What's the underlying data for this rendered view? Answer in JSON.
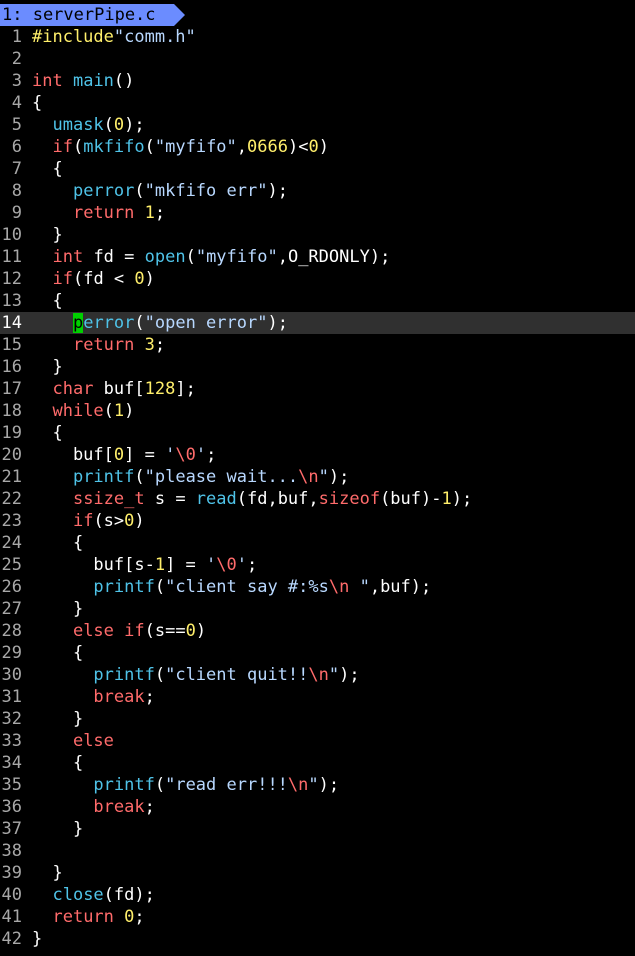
{
  "tab": {
    "label": "1: serverPipe.c"
  },
  "editor": {
    "current_line": 14,
    "lines": [
      [
        {
          "t": "#include",
          "c": "pp"
        },
        {
          "t": "\"comm.h\"",
          "c": "str"
        }
      ],
      [],
      [
        {
          "t": "int",
          "c": "ty"
        },
        {
          "t": " ",
          "c": "txt"
        },
        {
          "t": "main",
          "c": "fn"
        },
        {
          "t": "()",
          "c": "txt"
        }
      ],
      [
        {
          "t": "{",
          "c": "txt"
        }
      ],
      [
        {
          "t": "  ",
          "c": "txt"
        },
        {
          "t": "umask",
          "c": "fn"
        },
        {
          "t": "(",
          "c": "txt"
        },
        {
          "t": "0",
          "c": "num"
        },
        {
          "t": ");",
          "c": "txt"
        }
      ],
      [
        {
          "t": "  ",
          "c": "txt"
        },
        {
          "t": "if",
          "c": "kw"
        },
        {
          "t": "(",
          "c": "txt"
        },
        {
          "t": "mkfifo",
          "c": "fn"
        },
        {
          "t": "(",
          "c": "txt"
        },
        {
          "t": "\"myfifo\"",
          "c": "str"
        },
        {
          "t": ",",
          "c": "txt"
        },
        {
          "t": "0666",
          "c": "num"
        },
        {
          "t": ")<",
          "c": "txt"
        },
        {
          "t": "0",
          "c": "num"
        },
        {
          "t": ")",
          "c": "txt"
        }
      ],
      [
        {
          "t": "  {",
          "c": "txt"
        }
      ],
      [
        {
          "t": "    ",
          "c": "txt"
        },
        {
          "t": "perror",
          "c": "fn"
        },
        {
          "t": "(",
          "c": "txt"
        },
        {
          "t": "\"mkfifo err\"",
          "c": "str"
        },
        {
          "t": ");",
          "c": "txt"
        }
      ],
      [
        {
          "t": "    ",
          "c": "txt"
        },
        {
          "t": "return",
          "c": "kw"
        },
        {
          "t": " ",
          "c": "txt"
        },
        {
          "t": "1",
          "c": "num"
        },
        {
          "t": ";",
          "c": "txt"
        }
      ],
      [
        {
          "t": "  }",
          "c": "txt"
        }
      ],
      [
        {
          "t": "  ",
          "c": "txt"
        },
        {
          "t": "int",
          "c": "ty"
        },
        {
          "t": " fd = ",
          "c": "txt"
        },
        {
          "t": "open",
          "c": "fn"
        },
        {
          "t": "(",
          "c": "txt"
        },
        {
          "t": "\"myfifo\"",
          "c": "str"
        },
        {
          "t": ",O_RDONLY);",
          "c": "txt"
        }
      ],
      [
        {
          "t": "  ",
          "c": "txt"
        },
        {
          "t": "if",
          "c": "kw"
        },
        {
          "t": "(fd < ",
          "c": "txt"
        },
        {
          "t": "0",
          "c": "num"
        },
        {
          "t": ")",
          "c": "txt"
        }
      ],
      [
        {
          "t": "  {",
          "c": "txt"
        }
      ],
      [
        {
          "t": "    ",
          "c": "txt"
        },
        {
          "t": "p",
          "c": "cursor"
        },
        {
          "t": "error",
          "c": "fn"
        },
        {
          "t": "(",
          "c": "txt"
        },
        {
          "t": "\"open error\"",
          "c": "str"
        },
        {
          "t": ");",
          "c": "txt"
        }
      ],
      [
        {
          "t": "    ",
          "c": "txt"
        },
        {
          "t": "return",
          "c": "kw"
        },
        {
          "t": " ",
          "c": "txt"
        },
        {
          "t": "3",
          "c": "num"
        },
        {
          "t": ";",
          "c": "txt"
        }
      ],
      [
        {
          "t": "  }",
          "c": "txt"
        }
      ],
      [
        {
          "t": "  ",
          "c": "txt"
        },
        {
          "t": "char",
          "c": "ty"
        },
        {
          "t": " buf[",
          "c": "txt"
        },
        {
          "t": "128",
          "c": "num"
        },
        {
          "t": "];",
          "c": "txt"
        }
      ],
      [
        {
          "t": "  ",
          "c": "txt"
        },
        {
          "t": "while",
          "c": "kw"
        },
        {
          "t": "(",
          "c": "txt"
        },
        {
          "t": "1",
          "c": "num"
        },
        {
          "t": ")",
          "c": "txt"
        }
      ],
      [
        {
          "t": "  {",
          "c": "txt"
        }
      ],
      [
        {
          "t": "    buf[",
          "c": "txt"
        },
        {
          "t": "0",
          "c": "num"
        },
        {
          "t": "] = ",
          "c": "txt"
        },
        {
          "t": "'",
          "c": "str"
        },
        {
          "t": "\\0",
          "c": "esc"
        },
        {
          "t": "'",
          "c": "str"
        },
        {
          "t": ";",
          "c": "txt"
        }
      ],
      [
        {
          "t": "    ",
          "c": "txt"
        },
        {
          "t": "printf",
          "c": "fn"
        },
        {
          "t": "(",
          "c": "txt"
        },
        {
          "t": "\"please wait...",
          "c": "str"
        },
        {
          "t": "\\n",
          "c": "esc"
        },
        {
          "t": "\"",
          "c": "str"
        },
        {
          "t": ");",
          "c": "txt"
        }
      ],
      [
        {
          "t": "    ",
          "c": "txt"
        },
        {
          "t": "ssize_t",
          "c": "ty"
        },
        {
          "t": " s = ",
          "c": "txt"
        },
        {
          "t": "read",
          "c": "fn"
        },
        {
          "t": "(fd,buf,",
          "c": "txt"
        },
        {
          "t": "sizeof",
          "c": "kw"
        },
        {
          "t": "(buf)-",
          "c": "txt"
        },
        {
          "t": "1",
          "c": "num"
        },
        {
          "t": ");",
          "c": "txt"
        }
      ],
      [
        {
          "t": "    ",
          "c": "txt"
        },
        {
          "t": "if",
          "c": "kw"
        },
        {
          "t": "(s>",
          "c": "txt"
        },
        {
          "t": "0",
          "c": "num"
        },
        {
          "t": ")",
          "c": "txt"
        }
      ],
      [
        {
          "t": "    {",
          "c": "txt"
        }
      ],
      [
        {
          "t": "      buf[s-",
          "c": "txt"
        },
        {
          "t": "1",
          "c": "num"
        },
        {
          "t": "] = ",
          "c": "txt"
        },
        {
          "t": "'",
          "c": "str"
        },
        {
          "t": "\\0",
          "c": "esc"
        },
        {
          "t": "'",
          "c": "str"
        },
        {
          "t": ";",
          "c": "txt"
        }
      ],
      [
        {
          "t": "      ",
          "c": "txt"
        },
        {
          "t": "printf",
          "c": "fn"
        },
        {
          "t": "(",
          "c": "txt"
        },
        {
          "t": "\"client say #:%s",
          "c": "str"
        },
        {
          "t": "\\n",
          "c": "esc"
        },
        {
          "t": " \"",
          "c": "str"
        },
        {
          "t": ",buf);",
          "c": "txt"
        }
      ],
      [
        {
          "t": "    }",
          "c": "txt"
        }
      ],
      [
        {
          "t": "    ",
          "c": "txt"
        },
        {
          "t": "else",
          "c": "kw"
        },
        {
          "t": " ",
          "c": "txt"
        },
        {
          "t": "if",
          "c": "kw"
        },
        {
          "t": "(s==",
          "c": "txt"
        },
        {
          "t": "0",
          "c": "num"
        },
        {
          "t": ")",
          "c": "txt"
        }
      ],
      [
        {
          "t": "    {",
          "c": "txt"
        }
      ],
      [
        {
          "t": "      ",
          "c": "txt"
        },
        {
          "t": "printf",
          "c": "fn"
        },
        {
          "t": "(",
          "c": "txt"
        },
        {
          "t": "\"client quit!!",
          "c": "str"
        },
        {
          "t": "\\n",
          "c": "esc"
        },
        {
          "t": "\"",
          "c": "str"
        },
        {
          "t": ");",
          "c": "txt"
        }
      ],
      [
        {
          "t": "      ",
          "c": "txt"
        },
        {
          "t": "break",
          "c": "kw"
        },
        {
          "t": ";",
          "c": "txt"
        }
      ],
      [
        {
          "t": "    }",
          "c": "txt"
        }
      ],
      [
        {
          "t": "    ",
          "c": "txt"
        },
        {
          "t": "else",
          "c": "kw"
        }
      ],
      [
        {
          "t": "    {",
          "c": "txt"
        }
      ],
      [
        {
          "t": "      ",
          "c": "txt"
        },
        {
          "t": "printf",
          "c": "fn"
        },
        {
          "t": "(",
          "c": "txt"
        },
        {
          "t": "\"read err!!!",
          "c": "str"
        },
        {
          "t": "\\n",
          "c": "esc"
        },
        {
          "t": "\"",
          "c": "str"
        },
        {
          "t": ");",
          "c": "txt"
        }
      ],
      [
        {
          "t": "      ",
          "c": "txt"
        },
        {
          "t": "break",
          "c": "kw"
        },
        {
          "t": ";",
          "c": "txt"
        }
      ],
      [
        {
          "t": "    }",
          "c": "txt"
        }
      ],
      [],
      [
        {
          "t": "  }",
          "c": "txt"
        }
      ],
      [
        {
          "t": "  ",
          "c": "txt"
        },
        {
          "t": "close",
          "c": "fn"
        },
        {
          "t": "(fd);",
          "c": "txt"
        }
      ],
      [
        {
          "t": "  ",
          "c": "txt"
        },
        {
          "t": "return",
          "c": "kw"
        },
        {
          "t": " ",
          "c": "txt"
        },
        {
          "t": "0",
          "c": "num"
        },
        {
          "t": ";",
          "c": "txt"
        }
      ],
      [
        {
          "t": "}",
          "c": "txt"
        }
      ]
    ]
  },
  "colors": {
    "background": "#000000",
    "tab": "#6b8cff",
    "cursor": "#00d000",
    "current_line": "#303030",
    "keyword": "#ff6b6b",
    "function": "#4fc3e8",
    "string": "#b8d8ff",
    "number": "#ffef6b",
    "line_number": "#a8a8a8"
  }
}
